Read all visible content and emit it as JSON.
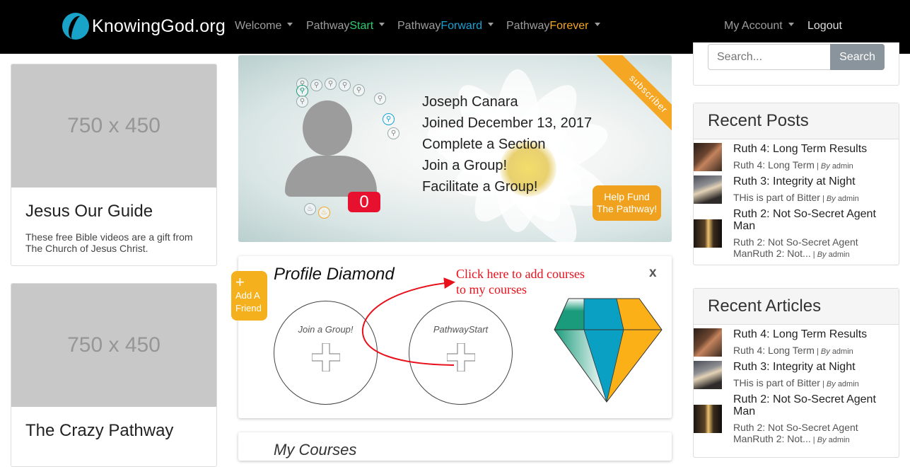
{
  "nav": {
    "logo_text": "KnowingGod.org",
    "welcome": "Welcome",
    "pathway_start_prefix": "Pathway",
    "pathway_start_suffix": "Start",
    "pathway_forward_prefix": "Pathway",
    "pathway_forward_suffix": "Forward",
    "pathway_forever_prefix": "Pathway",
    "pathway_forever_suffix": "Forever",
    "my_account": "My Account",
    "logout": "Logout",
    "colors": {
      "start": "#2ecc71",
      "forward": "#17a2d6",
      "forever": "#f5a623"
    }
  },
  "left": {
    "cards": [
      {
        "thumb": "750 x 450",
        "title": "Jesus Our Guide",
        "desc": "These free Bible videos are a gift from The Church of Jesus Christ."
      },
      {
        "thumb": "750 x 450",
        "title": "The Crazy Pathway",
        "desc": ""
      }
    ]
  },
  "profile": {
    "name": "Joseph Canara",
    "joined": "Joined December 13, 2017",
    "task1": "Complete a Section",
    "task2": "Join a Group!",
    "task3": "Facilitate a Group!",
    "score": "0",
    "ribbon": "subscriber",
    "fund_line1": "Help Fund",
    "fund_line2": "The Pathway!"
  },
  "diamond": {
    "title": "Profile Diamond",
    "close": "x",
    "add_friend_plus": "+",
    "add_friend_line1": "Add A",
    "add_friend_line2": "Friend",
    "hint_line1": "Click here to add courses",
    "hint_line2": "to my courses",
    "slot1_label": "Join a Group!",
    "slot2_label": "PathwayStart",
    "colors": {
      "teal": "#1a9b7b",
      "blue": "#0aa0c4",
      "orange": "#fbb017"
    }
  },
  "courses": {
    "title": "My Courses"
  },
  "sidebar": {
    "search_placeholder": "Search...",
    "search_button": "Search",
    "recent_posts_title": "Recent Posts",
    "recent_posts": [
      {
        "title": "Ruth 4: Long Term Results",
        "excerpt": "Ruth 4: Long Term",
        "by": "By",
        "author": "admin"
      },
      {
        "title": "Ruth 3: Integrity at Night",
        "excerpt": "THis is part of Bitter",
        "by": "By",
        "author": "admin"
      },
      {
        "title": "Ruth 2: Not So-Secret Agent Man",
        "excerpt": "Ruth 2: Not So-Secret Agent ManRuth 2: Not...",
        "by": "By",
        "author": "admin"
      }
    ],
    "recent_articles_title": "Recent Articles",
    "recent_articles": [
      {
        "title": "Ruth 4: Long Term Results",
        "excerpt": "Ruth 4: Long Term",
        "by": "By",
        "author": "admin"
      },
      {
        "title": "Ruth 3: Integrity at Night",
        "excerpt": "THis is part of Bitter",
        "by": "By",
        "author": "admin"
      },
      {
        "title": "Ruth 2: Not So-Secret Agent Man",
        "excerpt": "Ruth 2: Not So-Secret Agent ManRuth 2: Not...",
        "by": "By",
        "author": "admin"
      }
    ]
  }
}
